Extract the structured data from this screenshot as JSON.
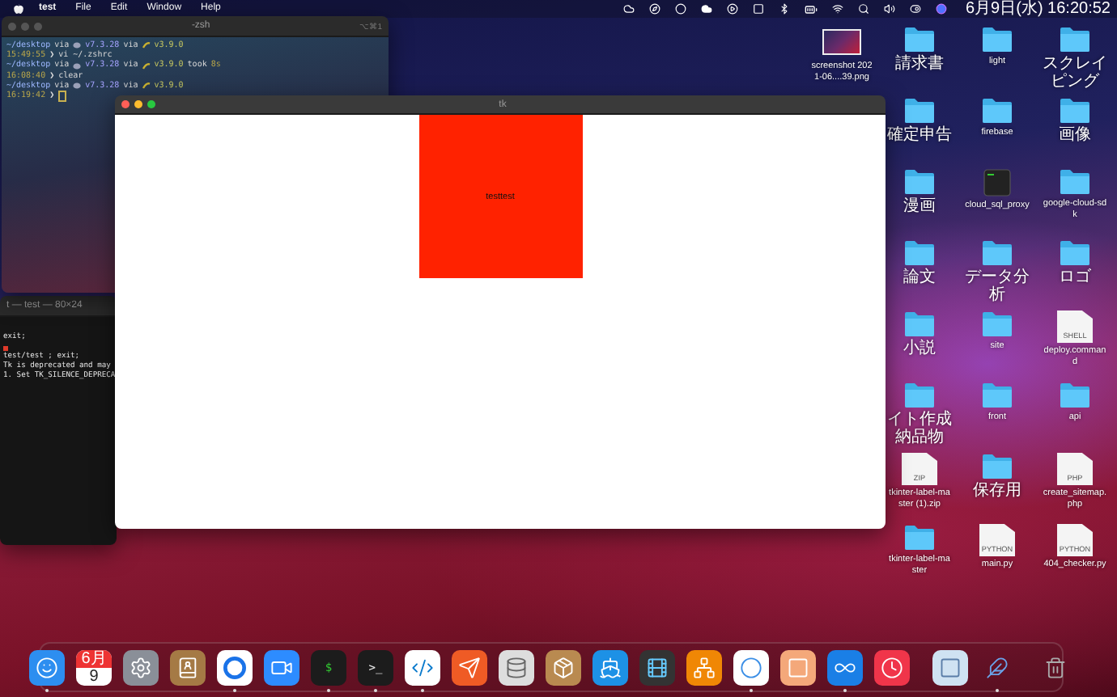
{
  "menu_bar": {
    "app": "test",
    "menus": [
      "File",
      "Edit",
      "Window",
      "Help"
    ],
    "clock": "6月9日(水)  16:20:52"
  },
  "terminal": {
    "title": "-zsh",
    "shortcut": "⌥⌘1",
    "lines": [
      {
        "cursor": false,
        "segments": [
          {
            "kind": "path",
            "text": "~/desktop"
          },
          {
            "kind": "plain",
            "text": "via"
          },
          {
            "kind": "php",
            "text": "v7.3.28"
          },
          {
            "kind": "plain",
            "text": "via"
          },
          {
            "kind": "python",
            "text": "v3.9.0"
          }
        ]
      },
      {
        "cursor": false,
        "segments": [
          {
            "kind": "time",
            "text": "15:49:55"
          },
          {
            "kind": "prompt",
            "text": "❯"
          },
          {
            "kind": "plain",
            "text": "vi ~/.zshrc"
          }
        ]
      },
      {
        "cursor": false,
        "segments": [
          {
            "kind": "path",
            "text": "~/desktop"
          },
          {
            "kind": "plain",
            "text": "via"
          },
          {
            "kind": "php",
            "text": "v7.3.28"
          },
          {
            "kind": "plain",
            "text": "via"
          },
          {
            "kind": "python",
            "text": "v3.9.0"
          },
          {
            "kind": "plain",
            "text": "took"
          },
          {
            "kind": "time",
            "text": "8s"
          }
        ]
      },
      {
        "cursor": false,
        "segments": [
          {
            "kind": "time",
            "text": "16:08:40"
          },
          {
            "kind": "prompt",
            "text": "❯"
          },
          {
            "kind": "plain",
            "text": "clear"
          }
        ]
      },
      {
        "cursor": false,
        "segments": [
          {
            "kind": "path",
            "text": "~/desktop"
          },
          {
            "kind": "plain",
            "text": "via"
          },
          {
            "kind": "php",
            "text": "v7.3.28"
          },
          {
            "kind": "plain",
            "text": "via"
          },
          {
            "kind": "python",
            "text": "v3.9.0"
          }
        ]
      },
      {
        "cursor": true,
        "segments": [
          {
            "kind": "time",
            "text": "16:19:42"
          },
          {
            "kind": "prompt",
            "text": "❯"
          }
        ]
      }
    ]
  },
  "terminal_back": {
    "title": "t — test — 80×24",
    "lines": [
      {
        "kind": "text",
        "text": "exit;"
      },
      {
        "kind": "mark"
      },
      {
        "kind": "text",
        "text": "test/test ; exit;"
      },
      {
        "kind": "text",
        "text": "Tk is deprecated and may"
      },
      {
        "kind": "text",
        "text": "1. Set TK_SILENCE_DEPRECA"
      }
    ]
  },
  "tk_window": {
    "title": "tk",
    "label": "testtest"
  },
  "desktop_rows": [
    [
      {
        "kind": "image",
        "name": "screenshot 2021-06....39.png"
      },
      {
        "kind": "folder",
        "name": "請求書"
      },
      {
        "kind": "folder",
        "name": "light"
      },
      {
        "kind": "folder",
        "name": "スクレイピング"
      }
    ],
    [
      {
        "kind": "folder",
        "name": "確定申告"
      },
      {
        "kind": "folder",
        "name": "firebase"
      },
      {
        "kind": "folder",
        "name": "画像"
      }
    ],
    [
      {
        "kind": "folder",
        "name": "漫画"
      },
      {
        "kind": "executable",
        "name": "cloud_sql_proxy"
      },
      {
        "kind": "folder",
        "name": "google-cloud-sdk"
      }
    ],
    [
      {
        "kind": "folder",
        "name": "論文"
      },
      {
        "kind": "folder",
        "name": "データ分析"
      },
      {
        "kind": "folder",
        "name": "ロゴ"
      }
    ],
    [
      {
        "kind": "folder",
        "name": "小説"
      },
      {
        "kind": "folder",
        "name": "site"
      },
      {
        "kind": "document",
        "name": "deploy.command",
        "badge": "SHELL"
      }
    ],
    [
      {
        "kind": "folder",
        "name": "イト作成納品物"
      },
      {
        "kind": "folder",
        "name": "front"
      },
      {
        "kind": "folder",
        "name": "api"
      }
    ],
    [
      {
        "kind": "archive",
        "name": "tkinter-label-master (1).zip",
        "badge": "ZIP"
      },
      {
        "kind": "folder",
        "name": "保存用"
      },
      {
        "kind": "document",
        "name": "create_sitemap.php",
        "badge": "PHP"
      }
    ],
    [
      {
        "kind": "folder",
        "name": "tkinter-label-master"
      },
      {
        "kind": "document",
        "name": "main.py",
        "badge": "PYTHON"
      },
      {
        "kind": "document",
        "name": "404_checker.py",
        "badge": "PYTHON"
      }
    ]
  ],
  "dock": [
    {
      "kind": "finder",
      "running": true
    },
    {
      "kind": "calendar",
      "running": false,
      "month": "6月",
      "day": "9"
    },
    {
      "kind": "gear",
      "running": false
    },
    {
      "kind": "contacts",
      "running": false
    },
    {
      "kind": "chrome",
      "running": true
    },
    {
      "kind": "camera",
      "running": false
    },
    {
      "kind": "console",
      "running": true,
      "glyph": "$"
    },
    {
      "kind": "console",
      "running": true,
      "glyph": ">_"
    },
    {
      "kind": "code",
      "running": true
    },
    {
      "kind": "rocket",
      "running": false
    },
    {
      "kind": "disks",
      "running": false
    },
    {
      "kind": "box",
      "running": false
    },
    {
      "kind": "whale",
      "running": false
    },
    {
      "kind": "player",
      "running": false
    },
    {
      "kind": "diagram",
      "running": false
    },
    {
      "kind": "ring",
      "running": true
    },
    {
      "kind": "pill",
      "running": false
    },
    {
      "kind": "infinity",
      "running": true
    },
    {
      "kind": "clock",
      "running": false
    },
    {
      "kind": "separator"
    },
    {
      "kind": "photo",
      "running": false
    },
    {
      "kind": "feather",
      "running": true
    },
    {
      "kind": "separator"
    },
    {
      "kind": "trash",
      "running": false
    }
  ]
}
